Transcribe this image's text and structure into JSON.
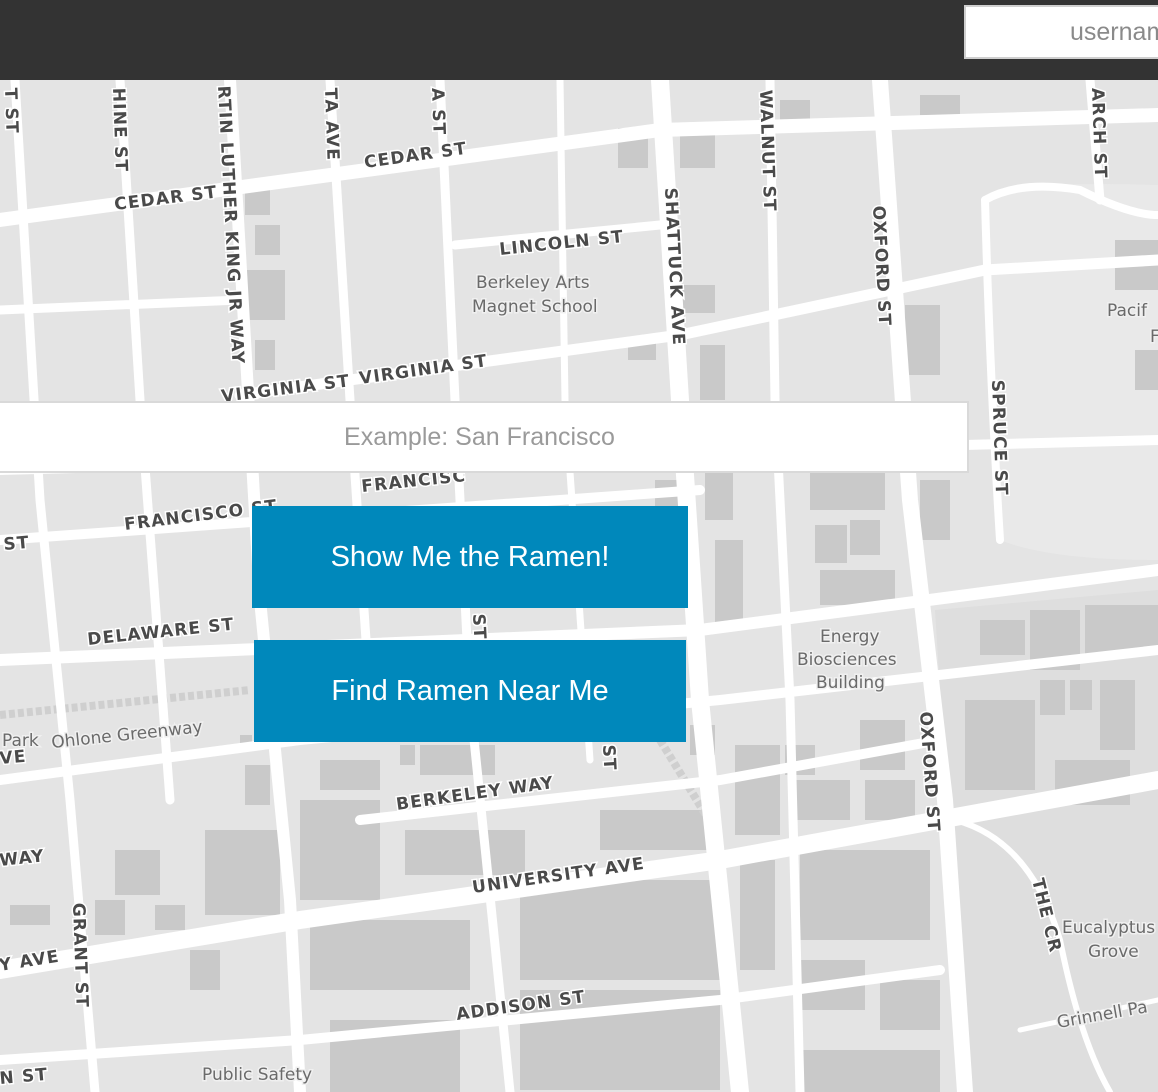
{
  "header": {
    "username_placeholder": "username"
  },
  "search": {
    "placeholder": "Example: San Francisco"
  },
  "buttons": {
    "show_ramen": "Show Me the Ramen!",
    "find_near_me": "Find Ramen Near Me"
  },
  "map": {
    "streets": {
      "cedar_1": "CEDAR ST",
      "cedar_2": "CEDAR ST",
      "lincoln": "LINCOLN ST",
      "virginia_1": "VIRGINIA ST",
      "virginia_2": "VIRGINIA ST",
      "francisco_1": "FRANCISCO ST",
      "francisco_2": "FRANCISC",
      "delaware": "DELAWARE ST",
      "berkeley_way": "BERKELEY WAY",
      "university": "UNIVERSITY AVE",
      "university_left": "Y AVE",
      "addison": "ADDISON ST",
      "shattuck": "SHATTUCK AVE",
      "oxford_1": "OXFORD ST",
      "oxford_2": "OXFORD ST",
      "walnut": "WALNUT ST",
      "spruce": "SPRUCE ST",
      "mlk": "RTIN LUTHER KING JR WAY",
      "hine": "HINE ST",
      "grant": "GRANT ST",
      "arch": "ARCH ST",
      "the_cr": "THE CR",
      "ta_ave": "TA AVE",
      "a_st": "A ST",
      "t_st_left": "T ST",
      "st_left": "ST",
      "way_left": "WAY",
      "ve_left": "VE",
      "n_st": "N ST",
      "st_mid": "ST",
      "st_mid2": "ST"
    },
    "places": {
      "arts_1": "Berkeley Arts",
      "arts_2": "Magnet School",
      "energy_1": "Energy",
      "energy_2": "Biosciences",
      "energy_3": "Building",
      "eucalyptus_1": "Eucalyptus",
      "eucalyptus_2": "Grove",
      "ohlone": "Ohlone Greenway",
      "park": "Park",
      "grinnell": "Grinnell Pa",
      "public_safety": "Public Safety",
      "pacific_1": "Pacif",
      "pacific_2": "F"
    }
  }
}
